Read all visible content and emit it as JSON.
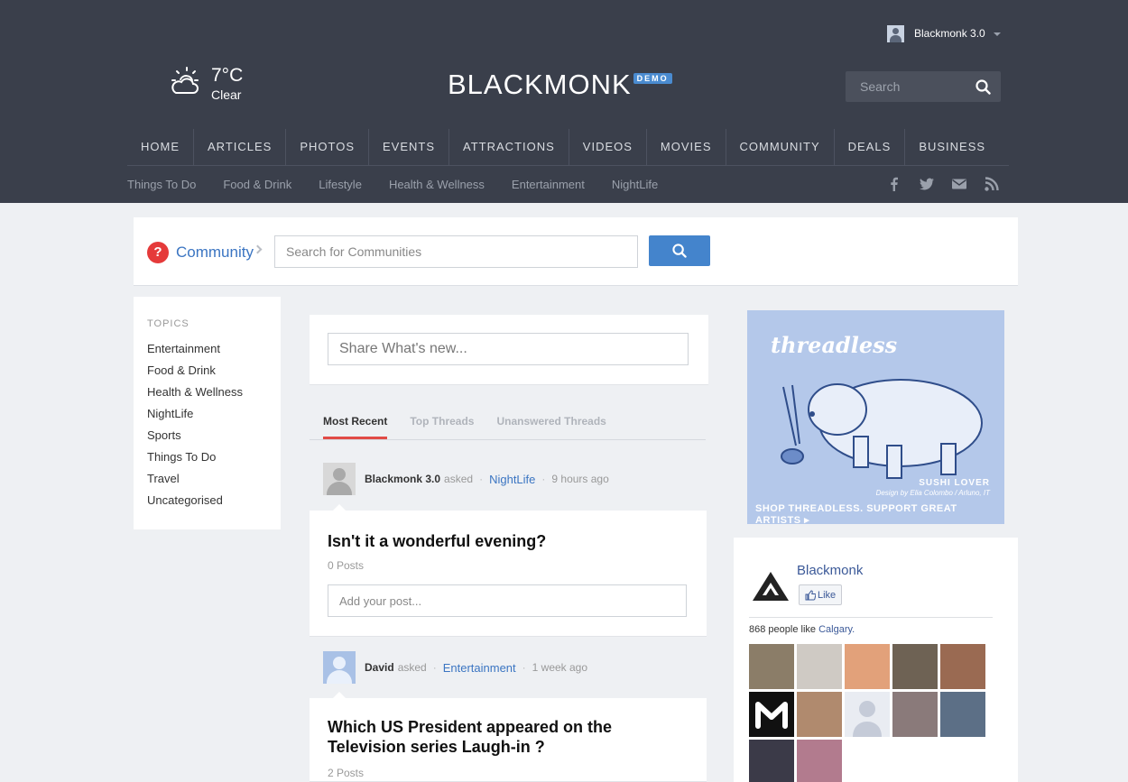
{
  "header": {
    "user": {
      "name": "Blackmonk 3.0"
    },
    "weather": {
      "temp": "7°C",
      "condition": "Clear"
    },
    "logo": {
      "text": "BLACKMONK",
      "badge": "DEMO"
    },
    "search": {
      "placeholder": "Search"
    },
    "main_nav": [
      "HOME",
      "ARTICLES",
      "PHOTOS",
      "EVENTS",
      "ATTRACTIONS",
      "VIDEOS",
      "MOVIES",
      "COMMUNITY",
      "DEALS",
      "BUSINESS"
    ],
    "sub_nav": [
      "Things To Do",
      "Food & Drink",
      "Lifestyle",
      "Health & Wellness",
      "Entertainment",
      "NightLife"
    ],
    "social_icons": [
      "facebook-icon",
      "twitter-icon",
      "mail-icon",
      "rss-icon"
    ]
  },
  "breadcrumb": {
    "icon": "question-icon",
    "icon_glyph": "?",
    "label": "Community",
    "search_placeholder": "Search for Communities"
  },
  "topics": {
    "heading": "TOPICS",
    "items": [
      "Entertainment",
      "Food & Drink",
      "Health & Wellness",
      "NightLife",
      "Sports",
      "Things To Do",
      "Travel",
      "Uncategorised"
    ]
  },
  "share": {
    "placeholder": "Share What's new..."
  },
  "tabs": [
    "Most Recent",
    "Top Threads",
    "Unanswered Threads"
  ],
  "posts": [
    {
      "user": "Blackmonk 3.0",
      "action": "asked",
      "category": "NightLife",
      "time": "9 hours ago",
      "title": "Isn't it a wonderful evening?",
      "posts_count": "0 Posts",
      "reply_placeholder": "Add your post..."
    },
    {
      "user": "David",
      "action": "asked",
      "category": "Entertainment",
      "time": "1 week ago",
      "title": "Which US President appeared on the Television series Laugh-in ?",
      "posts_count": "2 Posts"
    }
  ],
  "ad": {
    "brand": "threadless",
    "title": "SUSHI LOVER",
    "credit": "Design by Elia Colombo / Arluno, IT",
    "cta": "SHOP THREADLESS. SUPPORT GREAT ARTISTS ▸"
  },
  "facebook": {
    "page_name": "Blackmonk",
    "like_label": "Like",
    "count_text": "868 people like",
    "city": "Calgary."
  },
  "colors": {
    "header_bg": "#3a3f4b",
    "accent_blue": "#4484cc",
    "link_blue": "#3b75c2",
    "tab_active_red": "#e14b46",
    "question_red": "#e53a3a",
    "page_bg": "#eef0f3"
  }
}
